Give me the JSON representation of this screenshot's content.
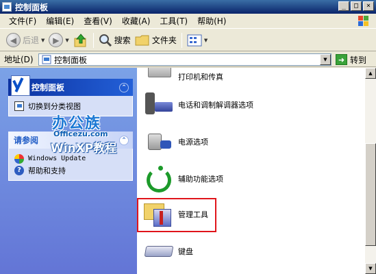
{
  "window": {
    "title": "控制面板",
    "controls": [
      "_",
      "□",
      "×"
    ]
  },
  "menu": [
    "文件(F)",
    "编辑(E)",
    "查看(V)",
    "收藏(A)",
    "工具(T)",
    "帮助(H)"
  ],
  "toolbar": {
    "back": "后退",
    "search": "搜索",
    "folders": "文件夹"
  },
  "address": {
    "label": "地址(D)",
    "value": "控制面板",
    "go": "转到"
  },
  "sidebar": {
    "control_panel": {
      "title": "控制面板",
      "links": [
        "切换到分类视图"
      ]
    },
    "see_also": {
      "title": "请参阅",
      "links": [
        "Windows Update",
        "帮助和支持"
      ]
    }
  },
  "watermark": {
    "logo": "办公族",
    "site": "Officezu.com",
    "sub": "WinXP教程"
  },
  "items": [
    {
      "label": "打印机和传真"
    },
    {
      "label": "电话和调制解调器选项"
    },
    {
      "label": "电源选项"
    },
    {
      "label": "辅助功能选项"
    },
    {
      "label": "管理工具"
    },
    {
      "label": "键盘"
    }
  ]
}
